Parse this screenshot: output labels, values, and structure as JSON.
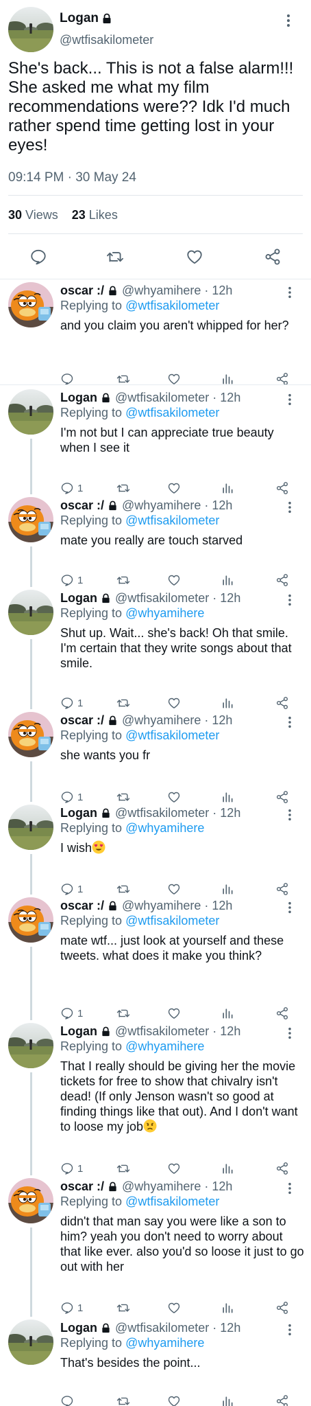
{
  "main_tweet": {
    "author_name": "Logan",
    "author_handle": "@wtfisakilometer",
    "text": "She's back... This is not a false alarm!!! She asked me what my film recommendations were?? Idk I'd much rather spend time getting lost in your eyes!",
    "timestamp": "09:14 PM · 30 May 24",
    "views_count": "30",
    "views_label": "Views",
    "likes_count": "23",
    "likes_label": "Likes"
  },
  "replies": [
    {
      "name": "oscar :/",
      "handle": "@whyamihere · 12h",
      "replying_label": "Replying to",
      "replying_to": "@wtfisakilometer",
      "text": "and you claim you aren't whipped for her?",
      "reply_count": ""
    },
    {
      "name": "Logan",
      "handle": "@wtfisakilometer · 12h",
      "replying_label": "Replying to",
      "replying_to": "@wtfisakilometer",
      "text": "I'm not but I can appreciate true beauty when I see it",
      "reply_count": "1"
    },
    {
      "name": "oscar :/",
      "handle": "@whyamihere · 12h",
      "replying_label": "Replying to",
      "replying_to": "@wtfisakilometer",
      "text": "mate you really are touch starved",
      "reply_count": "1"
    },
    {
      "name": "Logan",
      "handle": "@wtfisakilometer · 12h",
      "replying_label": "Replying to",
      "replying_to": "@whyamihere",
      "text": "Shut up. Wait... she's back! Oh that smile. I'm certain that they write songs about that smile.",
      "reply_count": "1"
    },
    {
      "name": "oscar :/",
      "handle": "@whyamihere · 12h",
      "replying_label": "Replying to",
      "replying_to": "@wtfisakilometer",
      "text": "she wants you fr",
      "reply_count": "1"
    },
    {
      "name": "Logan",
      "handle": "@wtfisakilometer · 12h",
      "replying_label": "Replying to",
      "replying_to": "@whyamihere",
      "text": "I wish",
      "reply_count": "1",
      "emoji": "heart-eyes-emoji"
    },
    {
      "name": "oscar :/",
      "handle": "@whyamihere · 12h",
      "replying_label": "Replying to",
      "replying_to": "@wtfisakilometer",
      "text": "mate wtf... just look at yourself and these tweets. what does it make you think?",
      "reply_count": "1"
    },
    {
      "name": "Logan",
      "handle": "@wtfisakilometer · 12h",
      "replying_label": "Replying to",
      "replying_to": "@whyamihere",
      "text": "That I really should be giving her the movie tickets for free to show that chivalry isn't dead! (If only Jenson wasn't so good at finding things like that out). And I don't want to loose my job",
      "reply_count": "1",
      "emoji": "worried-emoji"
    },
    {
      "name": "oscar :/",
      "handle": "@whyamihere · 12h",
      "replying_label": "Replying to",
      "replying_to": "@wtfisakilometer",
      "text": "didn't that man say you were like a son to him? yeah you don't need to worry about that like ever. also you'd so loose it just to go out with her",
      "reply_count": "1"
    },
    {
      "name": "Logan",
      "handle": "@wtfisakilometer · 12h",
      "replying_label": "Replying to",
      "replying_to": "@whyamihere",
      "text": "That's besides the point...",
      "reply_count": ""
    }
  ],
  "colors": {
    "accent": "#1d9bf0",
    "secondary_text": "#536471",
    "primary_text": "#0f1419",
    "divider": "#e6ecf0"
  }
}
